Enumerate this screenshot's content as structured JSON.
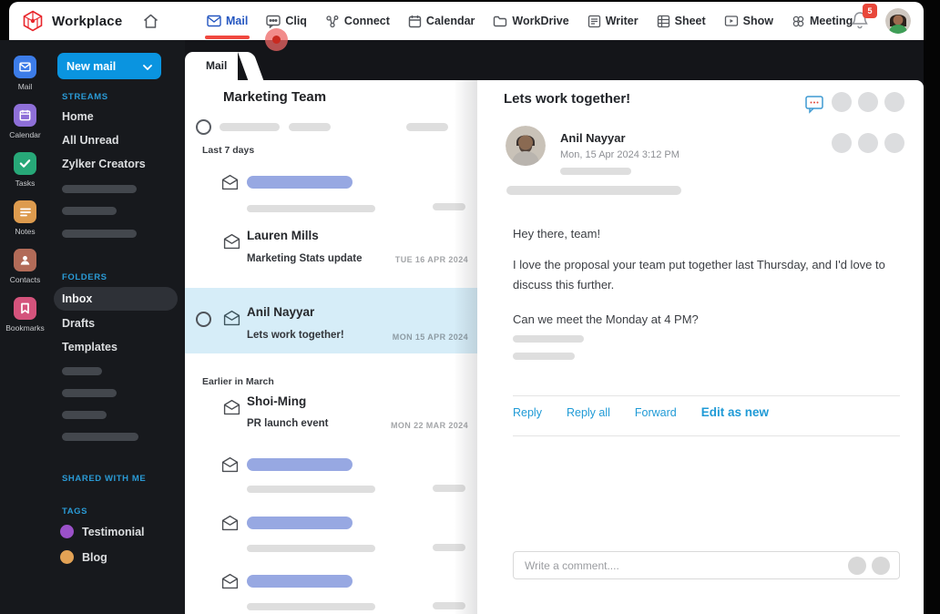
{
  "topbar": {
    "brand": "Workplace",
    "nav": [
      {
        "label": "Mail"
      },
      {
        "label": "Cliq"
      },
      {
        "label": "Connect"
      },
      {
        "label": "Calendar"
      },
      {
        "label": "WorkDrive"
      },
      {
        "label": "Writer"
      },
      {
        "label": "Sheet"
      },
      {
        "label": "Show"
      },
      {
        "label": "Meeting"
      }
    ],
    "notification_count": "5"
  },
  "app_rail": {
    "items": [
      {
        "label": "Mail",
        "color": "#3c7ce8"
      },
      {
        "label": "Calendar",
        "color": "#8e6fd8"
      },
      {
        "label": "Tasks",
        "color": "#27a878"
      },
      {
        "label": "Notes",
        "color": "#dd9b4e"
      },
      {
        "label": "Contacts",
        "color": "#b26b58"
      },
      {
        "label": "Bookmarks",
        "color": "#d4537c"
      }
    ]
  },
  "sidebar": {
    "new_mail_label": "New mail",
    "streams_label": "STREAMS",
    "streams": [
      "Home",
      "All Unread",
      "Zylker Creators"
    ],
    "folders_label": "FOLDERS",
    "folders": [
      "Inbox",
      "Drafts",
      "Templates"
    ],
    "selected_folder": "Inbox",
    "shared_label": "SHARED WITH ME",
    "tags_label": "TAGS",
    "tags": [
      {
        "name": "Testimonial",
        "color": "#9b51c9"
      },
      {
        "name": "Blog",
        "color": "#e2a255"
      }
    ]
  },
  "mail_tab": "Mail",
  "mail_list": {
    "title": "Marketing Team",
    "group_recent": "Last 7 days",
    "group_earlier": "Earlier in March",
    "items": [
      {
        "sender": "Lauren Mills",
        "subject": "Marketing Stats update",
        "date": "TUE 16 APR 2024"
      },
      {
        "sender": "Anil Nayyar",
        "subject": "Lets work together!",
        "date": "MON 15 APR 2024"
      },
      {
        "sender": "Shoi-Ming",
        "subject": "PR launch event",
        "date": "MON 22 MAR 2024"
      }
    ]
  },
  "reading_pane": {
    "subject": "Lets work together!",
    "sender_name": "Anil Nayyar",
    "sent_datetime": "Mon, 15 Apr 2024  3:12 PM",
    "body": {
      "p1": "Hey there, team!",
      "p2": "I love the proposal your team put together last Thursday, and I'd love to discuss this further.",
      "p3": "Can we meet the Monday at 4 PM?"
    },
    "actions": {
      "reply": "Reply",
      "reply_all": "Reply all",
      "forward": "Forward",
      "edit_as_new": "Edit as new"
    },
    "comment_placeholder": "Write a comment...."
  },
  "colors": {
    "brand_red": "#e8262c",
    "nav_active_blue": "#2456c0",
    "underline_red": "#f0483f",
    "accent_blue": "#0a94e0",
    "section_label_blue": "#2a9ad5",
    "selected_mail_bg": "#d6edf8",
    "unread_bar": "#97a8e2",
    "link_blue": "#1f9ad6",
    "badge_red": "#e8473a"
  }
}
